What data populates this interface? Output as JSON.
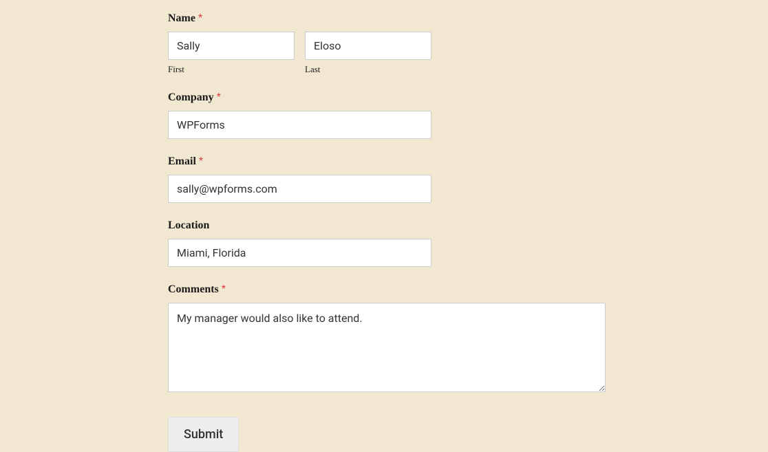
{
  "form": {
    "name": {
      "label": "Name",
      "first_sub": "First",
      "last_sub": "Last",
      "first_value": "Sally",
      "last_value": "Eloso",
      "required": true
    },
    "company": {
      "label": "Company",
      "value": "WPForms",
      "required": true
    },
    "email": {
      "label": "Email",
      "value": "sally@wpforms.com",
      "required": true
    },
    "location": {
      "label": "Location",
      "value": "Miami, Florida",
      "required": false
    },
    "comments": {
      "label": "Comments",
      "value": "My manager would also like to attend.",
      "required": true
    },
    "submit_label": "Submit",
    "required_marker": "*"
  }
}
